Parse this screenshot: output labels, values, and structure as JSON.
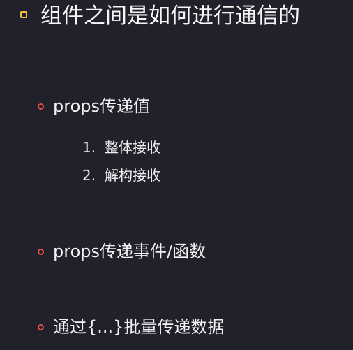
{
  "slide": {
    "title": "组件之间是如何进行通信的",
    "colors": {
      "background": "#20212b",
      "title_bullet": "#f3c23a",
      "item_bullet": "#e0533a",
      "text": "#f2f2f2"
    },
    "items": [
      {
        "label": "props传递值",
        "subitems": [
          {
            "number": "1.",
            "label": "整体接收"
          },
          {
            "number": "2.",
            "label": "解构接收"
          }
        ]
      },
      {
        "label": "props传递事件/函数"
      },
      {
        "label": "通过{...}批量传递数据"
      }
    ]
  }
}
